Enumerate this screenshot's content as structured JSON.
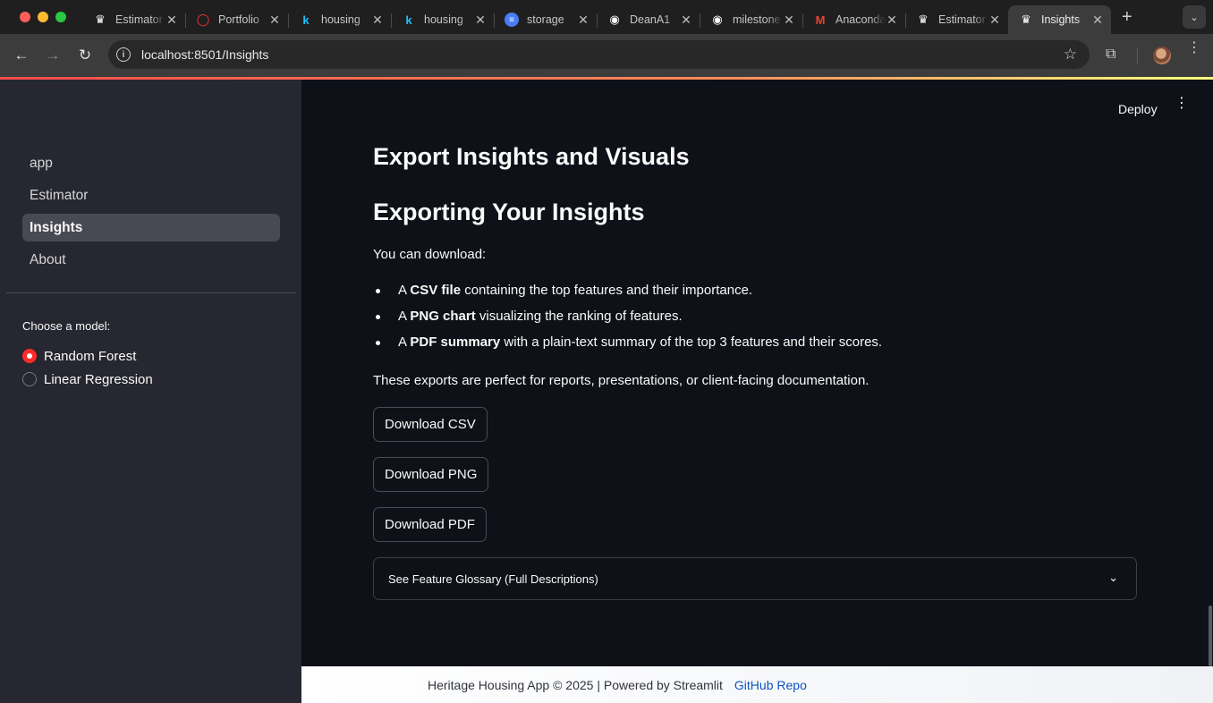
{
  "browser": {
    "tabs": [
      {
        "title": "Estimator",
        "icon": "streamlit-crown-icon",
        "icon_color": "#ffffff"
      },
      {
        "title": "Portfolio",
        "icon": "opera-o-icon",
        "icon_color": "#ff3b30"
      },
      {
        "title": "housing",
        "icon": "kaggle-k-icon",
        "icon_color": "#20beff"
      },
      {
        "title": "housing",
        "icon": "kaggle-k-icon",
        "icon_color": "#20beff"
      },
      {
        "title": "storage",
        "icon": "cloud-storage-icon",
        "icon_color": "#4a7cf5"
      },
      {
        "title": "DeanA1",
        "icon": "github-icon",
        "icon_color": "#ffffff"
      },
      {
        "title": "milestone",
        "icon": "github-icon",
        "icon_color": "#ffffff"
      },
      {
        "title": "Anaconda",
        "icon": "gmail-icon",
        "icon_color": "#ea4335"
      },
      {
        "title": "Estimator",
        "icon": "streamlit-crown-icon",
        "icon_color": "#ffffff"
      },
      {
        "title": "Insights",
        "icon": "streamlit-crown-icon",
        "icon_color": "#ffffff",
        "active": true
      }
    ],
    "url": "localhost:8501/Insights"
  },
  "header": {
    "deploy_label": "Deploy"
  },
  "sidebar": {
    "nav": [
      {
        "label": "app"
      },
      {
        "label": "Estimator"
      },
      {
        "label": "Insights",
        "active": true
      },
      {
        "label": "About"
      }
    ],
    "model_label": "Choose a model:",
    "model_options": [
      {
        "label": "Random Forest",
        "checked": true
      },
      {
        "label": "Linear Regression",
        "checked": false
      }
    ]
  },
  "main": {
    "title": "Export Insights and Visuals",
    "subtitle": "Exporting Your Insights",
    "intro": "You can download:",
    "bullets": [
      {
        "prefix": "A ",
        "bold": "CSV file",
        "rest": " containing the top features and their importance."
      },
      {
        "prefix": "A ",
        "bold": "PNG chart",
        "rest": " visualizing the ranking of features."
      },
      {
        "prefix": "A ",
        "bold": "PDF summary",
        "rest": " with a plain-text summary of the top 3 features and their scores."
      }
    ],
    "outro": "These exports are perfect for reports, presentations, or client-facing documentation.",
    "buttons": {
      "csv": "Download CSV",
      "png": "Download PNG",
      "pdf": "Download PDF"
    },
    "expander_label": "See Feature Glossary (Full Descriptions)"
  },
  "footer": {
    "text": "Heritage Housing App © 2025 | Powered by Streamlit",
    "link": "GitHub Repo"
  },
  "colors": {
    "accent": "#ff4b4b",
    "link": "#0b53bf",
    "sidebar_bg": "#262730",
    "main_bg": "#0e1117"
  }
}
